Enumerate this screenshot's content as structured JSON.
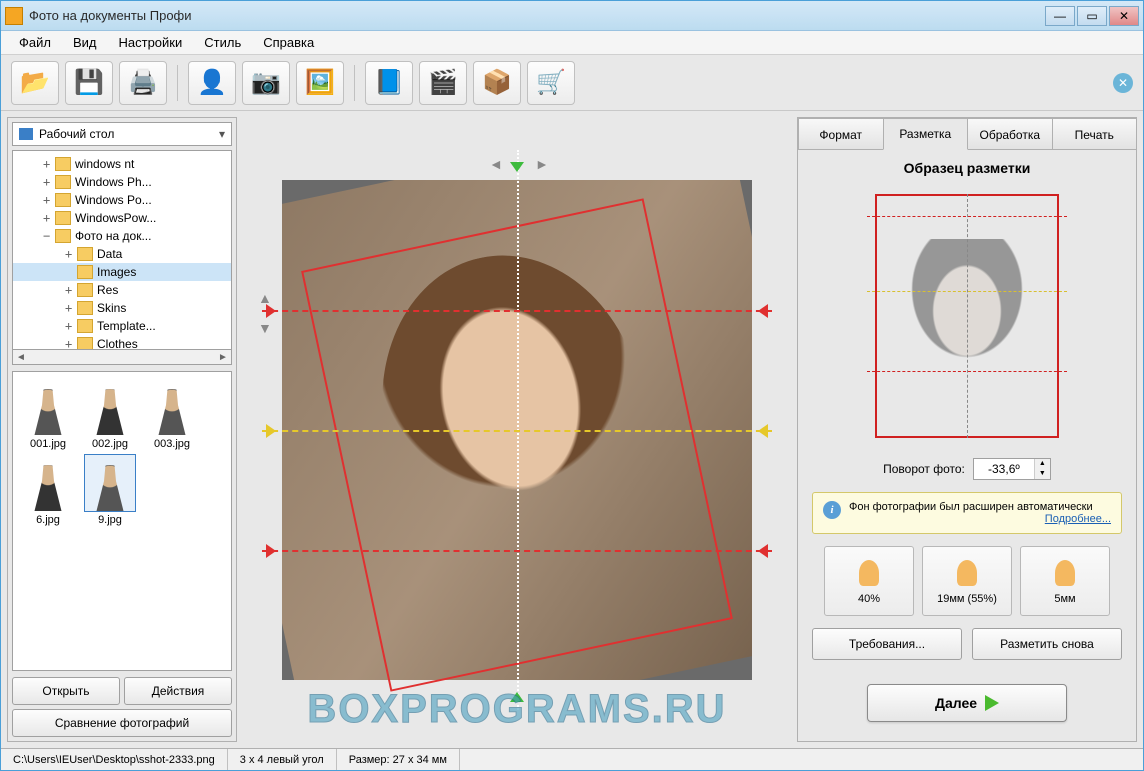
{
  "title": "Фото на документы Профи",
  "menu": [
    "Файл",
    "Вид",
    "Настройки",
    "Стиль",
    "Справка"
  ],
  "toolbar_icons": [
    "folder-open-icon",
    "save-icon",
    "print-icon",
    "user-add-icon",
    "camera-icon",
    "image-settings-icon",
    "help-icon",
    "video-icon",
    "package-icon",
    "cart-icon"
  ],
  "combo": "Рабочий стол",
  "tree": [
    {
      "lvl": 1,
      "exp": "+",
      "label": "windows nt"
    },
    {
      "lvl": 1,
      "exp": "+",
      "label": "Windows Ph..."
    },
    {
      "lvl": 1,
      "exp": "+",
      "label": "Windows Po..."
    },
    {
      "lvl": 1,
      "exp": "+",
      "label": "WindowsPow..."
    },
    {
      "lvl": 1,
      "exp": "−",
      "label": "Фото на док..."
    },
    {
      "lvl": 2,
      "exp": "+",
      "label": "Data"
    },
    {
      "lvl": 2,
      "exp": "",
      "label": "Images",
      "sel": true
    },
    {
      "lvl": 2,
      "exp": "+",
      "label": "Res"
    },
    {
      "lvl": 2,
      "exp": "+",
      "label": "Skins"
    },
    {
      "lvl": 2,
      "exp": "+",
      "label": "Template..."
    },
    {
      "lvl": 2,
      "exp": "+",
      "label": "Clothes"
    }
  ],
  "thumbs": [
    "001.jpg",
    "002.jpg",
    "003.jpg",
    "6.jpg",
    "9.jpg"
  ],
  "thumb_selected": 4,
  "left_buttons": {
    "open": "Открыть",
    "actions": "Действия",
    "compare": "Сравнение фотографий"
  },
  "tabs": [
    "Формат",
    "Разметка",
    "Обработка",
    "Печать"
  ],
  "active_tab": 1,
  "section_title": "Образец разметки",
  "rotation": {
    "label": "Поворот фото:",
    "value": "-33,6º"
  },
  "info": {
    "text": "Фон фотографии был расширен автоматически",
    "link": "Подробнее..."
  },
  "metrics": [
    {
      "icon": "head-size-icon",
      "label": "40%"
    },
    {
      "icon": "head-top-icon",
      "label": "19мм (55%)"
    },
    {
      "icon": "head-width-icon",
      "label": "5мм"
    }
  ],
  "actions": {
    "req": "Требования...",
    "remark": "Разметить снова",
    "next": "Далее"
  },
  "status": {
    "path": "C:\\Users\\IEUser\\Desktop\\sshot-2333.png",
    "corner": "3 x 4 левый угол",
    "size": "Размер: 27 x 34 мм"
  },
  "watermark": "BOXPROGRAMS.RU"
}
